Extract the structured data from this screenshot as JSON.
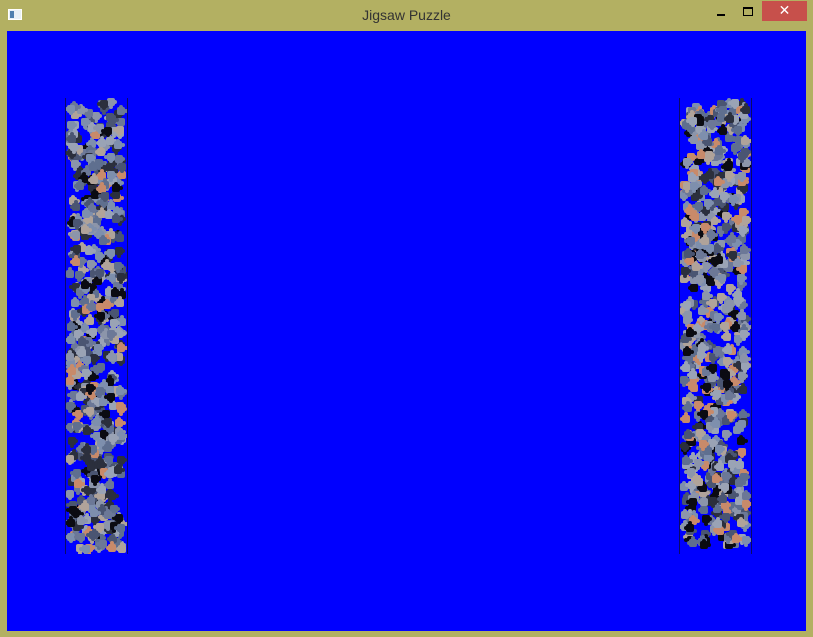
{
  "window": {
    "title": "Jigsaw Puzzle",
    "minimize_icon": "minimize-icon",
    "maximize_icon": "maximize-icon",
    "close_icon": "close-icon",
    "close_glyph": "✕"
  },
  "colors": {
    "frame": "#b3b062",
    "canvas": "#0000ff",
    "close_button": "#c7504b",
    "piece_palette": [
      "#7e8fad",
      "#5f6f8f",
      "#9aa3b5",
      "#2b2f3d",
      "#0b0b12",
      "#6c7897",
      "#b0a39a",
      "#c88a6a",
      "#4a5572",
      "#8c95aa"
    ]
  },
  "board": {
    "left_tray": {
      "label": "left-piece-tray",
      "piece_count": 520
    },
    "right_tray": {
      "label": "right-piece-tray",
      "piece_count": 620
    }
  }
}
